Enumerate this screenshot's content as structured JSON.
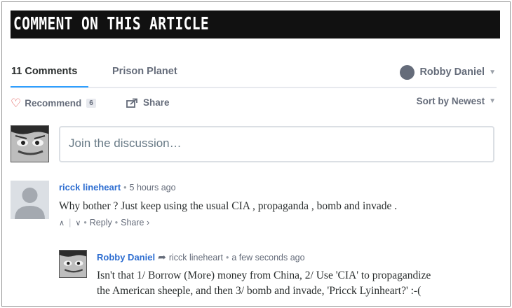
{
  "banner": {
    "title": "COMMENT ON THIS ARTICLE"
  },
  "nav": {
    "comments_tab": "11 Comments",
    "community_tab": "Prison Planet",
    "user_name": "Robby Daniel"
  },
  "actions": {
    "recommend_label": "Recommend",
    "recommend_count": "6",
    "share_label": "Share",
    "sort_label": "Sort by Newest"
  },
  "compose": {
    "placeholder": "Join the discussion…"
  },
  "comments": [
    {
      "author": "ricck lineheart",
      "time": "5 hours ago",
      "body": "Why bother ? Just keep using the usual CIA , propaganda , bomb and invade .",
      "reply_label": "Reply",
      "share_label": "Share ›",
      "replies": [
        {
          "author": "Robby Daniel",
          "in_reply_to": "ricck lineheart",
          "time": "a few seconds ago",
          "body_lines": [
            "Isn't that 1/ Borrow (More) money from China, 2/ Use 'CIA' to propagandize",
            "the American sheeple, and then 3/ bomb and invade, 'Pricck Lyinheart?' :-("
          ]
        }
      ]
    }
  ],
  "colors": {
    "accent_blue": "#2e9fff",
    "author_link": "#2e6ed1",
    "heart": "#e0514f",
    "muted": "#656c7a"
  }
}
